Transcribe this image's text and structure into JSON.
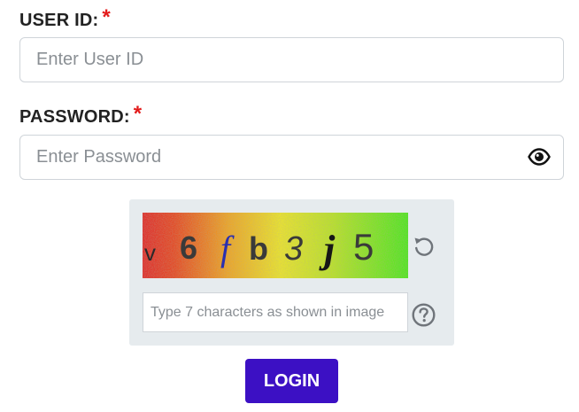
{
  "user_id": {
    "label": "USER ID:",
    "required_mark": "*",
    "placeholder": "Enter User ID",
    "value": ""
  },
  "password": {
    "label": "PASSWORD:",
    "required_mark": "*",
    "placeholder": "Enter Password",
    "value": "",
    "toggle_icon": "eye-icon"
  },
  "captcha": {
    "characters": [
      "v",
      "6",
      "f",
      "b",
      "3",
      "j",
      "5"
    ],
    "input_placeholder": "Type 7 characters as shown in image",
    "input_value": "",
    "refresh_icon": "refresh-icon",
    "help_icon": "question-circle-icon"
  },
  "login": {
    "label": "LOGIN"
  },
  "colors": {
    "accent_button": "#3c10c4",
    "required_mark": "#e31b1b",
    "captcha_panel": "#e6ebee",
    "label_text": "#222222"
  }
}
